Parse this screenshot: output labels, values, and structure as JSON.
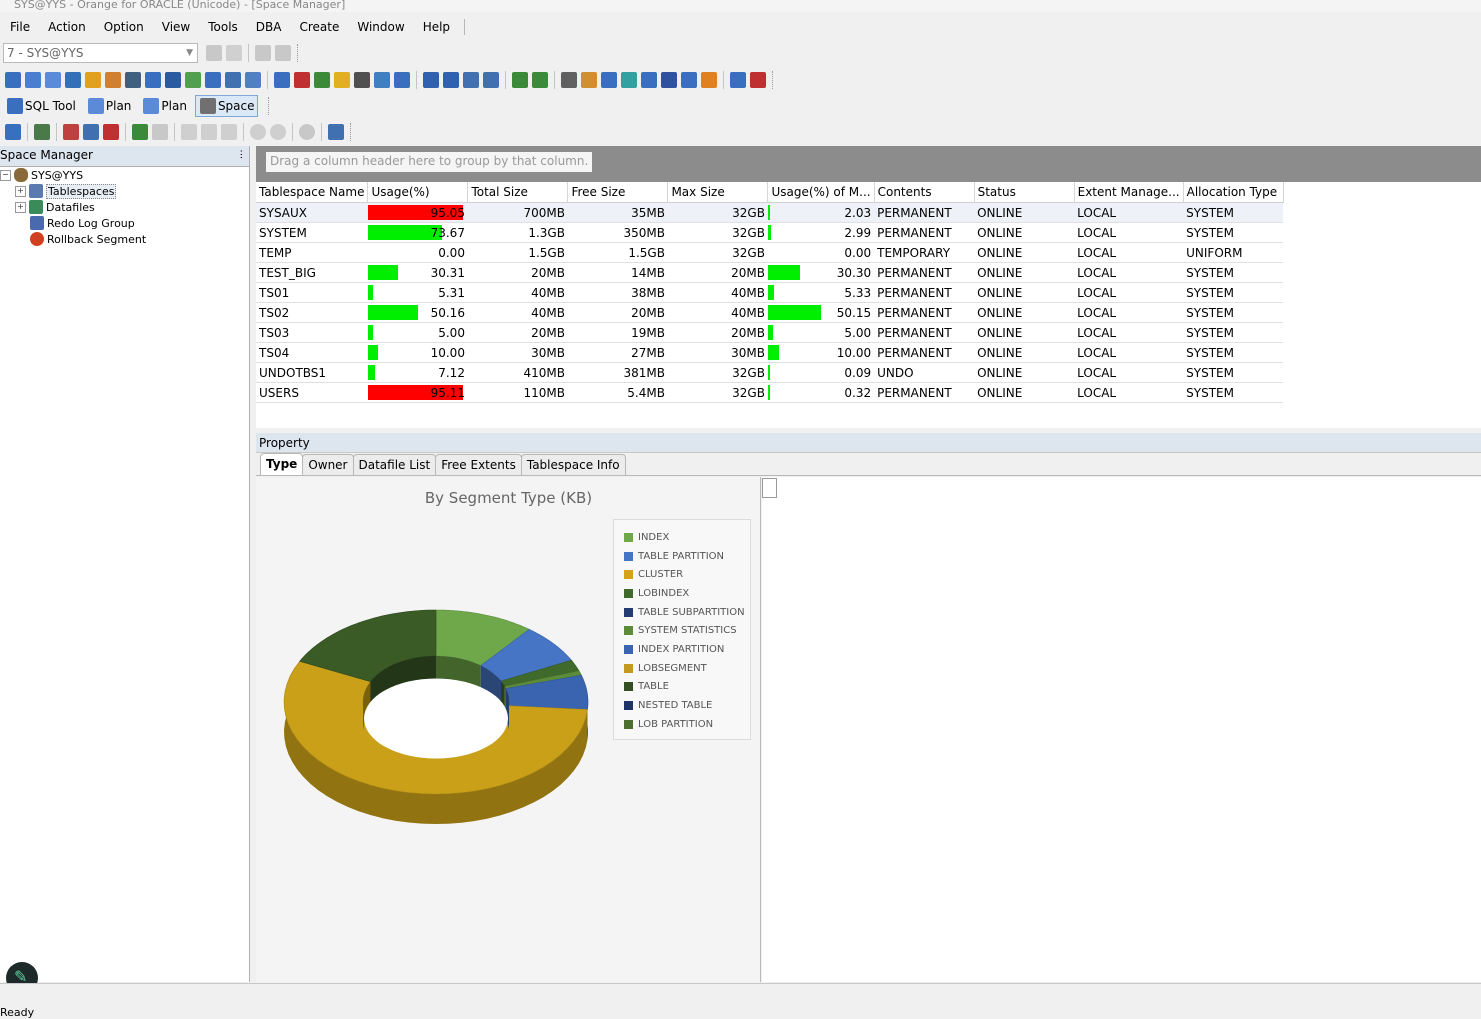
{
  "window": {
    "title": "SYS@YYS - Orange for ORACLE (Unicode) - [Space Manager]"
  },
  "menu": [
    "File",
    "Action",
    "Option",
    "View",
    "Tools",
    "DBA",
    "Create",
    "Window",
    "Help"
  ],
  "connection": {
    "value": "7 - SYS@YYS"
  },
  "tool_tabs": [
    {
      "label": "SQL Tool",
      "icon": "sql-tool-icon"
    },
    {
      "label": "Plan",
      "icon": "plan-icon"
    },
    {
      "label": "Plan",
      "icon": "plan-icon"
    },
    {
      "label": "Space",
      "icon": "space-icon"
    }
  ],
  "left_panel": {
    "title": "Space Manager",
    "tree": {
      "root": "SYS@YYS",
      "children": [
        "Tablespaces",
        "Datafiles",
        "Redo Log Group",
        "Rollback Segment"
      ]
    }
  },
  "grid": {
    "group_hint": "Drag a column header here to group by that column.",
    "columns": [
      "Tablespace Name",
      "Usage(%)",
      "Total Size",
      "Free Size",
      "Max Size",
      "Usage(%) of M...",
      "Contents",
      "Status",
      "Extent Manage...",
      "Allocation Type"
    ],
    "rows": [
      {
        "name": "SYSAUX",
        "usage": "95.05",
        "usage_val": 95.05,
        "total": "700MB",
        "free": "35MB",
        "max": "32GB",
        "usage_max": "2.03",
        "usage_max_val": 2.03,
        "contents": "PERMANENT",
        "status": "ONLINE",
        "extent": "LOCAL",
        "alloc": "SYSTEM"
      },
      {
        "name": "SYSTEM",
        "usage": "73.67",
        "usage_val": 73.67,
        "total": "1.3GB",
        "free": "350MB",
        "max": "32GB",
        "usage_max": "2.99",
        "usage_max_val": 2.99,
        "contents": "PERMANENT",
        "status": "ONLINE",
        "extent": "LOCAL",
        "alloc": "SYSTEM"
      },
      {
        "name": "TEMP",
        "usage": "0.00",
        "usage_val": 0,
        "total": "1.5GB",
        "free": "1.5GB",
        "max": "32GB",
        "usage_max": "0.00",
        "usage_max_val": 0,
        "contents": "TEMPORARY",
        "status": "ONLINE",
        "extent": "LOCAL",
        "alloc": "UNIFORM"
      },
      {
        "name": "TEST_BIG",
        "usage": "30.31",
        "usage_val": 30.31,
        "total": "20MB",
        "free": "14MB",
        "max": "20MB",
        "usage_max": "30.30",
        "usage_max_val": 30.3,
        "contents": "PERMANENT",
        "status": "ONLINE",
        "extent": "LOCAL",
        "alloc": "SYSTEM"
      },
      {
        "name": "TS01",
        "usage": "5.31",
        "usage_val": 5.31,
        "total": "40MB",
        "free": "38MB",
        "max": "40MB",
        "usage_max": "5.33",
        "usage_max_val": 5.33,
        "contents": "PERMANENT",
        "status": "ONLINE",
        "extent": "LOCAL",
        "alloc": "SYSTEM"
      },
      {
        "name": "TS02",
        "usage": "50.16",
        "usage_val": 50.16,
        "total": "40MB",
        "free": "20MB",
        "max": "40MB",
        "usage_max": "50.15",
        "usage_max_val": 50.15,
        "contents": "PERMANENT",
        "status": "ONLINE",
        "extent": "LOCAL",
        "alloc": "SYSTEM"
      },
      {
        "name": "TS03",
        "usage": "5.00",
        "usage_val": 5.0,
        "total": "20MB",
        "free": "19MB",
        "max": "20MB",
        "usage_max": "5.00",
        "usage_max_val": 5.0,
        "contents": "PERMANENT",
        "status": "ONLINE",
        "extent": "LOCAL",
        "alloc": "SYSTEM"
      },
      {
        "name": "TS04",
        "usage": "10.00",
        "usage_val": 10.0,
        "total": "30MB",
        "free": "27MB",
        "max": "30MB",
        "usage_max": "10.00",
        "usage_max_val": 10.0,
        "contents": "PERMANENT",
        "status": "ONLINE",
        "extent": "LOCAL",
        "alloc": "SYSTEM"
      },
      {
        "name": "UNDOTBS1",
        "usage": "7.12",
        "usage_val": 7.12,
        "total": "410MB",
        "free": "381MB",
        "max": "32GB",
        "usage_max": "0.09",
        "usage_max_val": 0.09,
        "contents": "UNDO",
        "status": "ONLINE",
        "extent": "LOCAL",
        "alloc": "SYSTEM"
      },
      {
        "name": "USERS",
        "usage": "95.11",
        "usage_val": 95.11,
        "total": "110MB",
        "free": "5.4MB",
        "max": "32GB",
        "usage_max": "0.32",
        "usage_max_val": 0.32,
        "contents": "PERMANENT",
        "status": "ONLINE",
        "extent": "LOCAL",
        "alloc": "SYSTEM"
      }
    ],
    "colors": {
      "high": "#ff0000",
      "normal": "#00ee00"
    }
  },
  "property": {
    "title": "Property",
    "tabs": [
      "Type",
      "Owner",
      "Datafile List",
      "Free Extents",
      "Tablespace Info"
    ],
    "active_tab": "Type"
  },
  "chart_data": {
    "type": "pie",
    "subtype": "3d-donut",
    "title": "By Segment Type (KB)",
    "legend_position": "right",
    "legend": [
      "INDEX",
      "TABLE PARTITION",
      "CLUSTER",
      "LOBINDEX",
      "TABLE SUBPARTITION",
      "SYSTEM STATISTICS",
      "INDEX PARTITION",
      "LOBSEGMENT",
      "TABLE",
      "NESTED TABLE",
      "LOB PARTITION"
    ],
    "legend_colors": [
      "#6fa84a",
      "#4575c4",
      "#d4a31a",
      "#3f6a2c",
      "#243c70",
      "#5c8c3a",
      "#3a64b0",
      "#c29a20",
      "#354f24",
      "#1e3466",
      "#4c6e30"
    ],
    "slices": [
      {
        "name": "INDEX",
        "value": 10.5,
        "color": "#6fa84a"
      },
      {
        "name": "TABLE PARTITION",
        "value": 7.0,
        "color": "#4575c4"
      },
      {
        "name": "LOBINDEX",
        "value": 2.0,
        "color": "#3f6a2c"
      },
      {
        "name": "SYSTEM STATISTICS",
        "value": 0.8,
        "color": "#5c8c3a"
      },
      {
        "name": "INDEX PARTITION",
        "value": 6.0,
        "color": "#3a64b0"
      },
      {
        "name": "LOBSEGMENT",
        "value": 56.0,
        "color": "#c9a017"
      },
      {
        "name": "TABLE",
        "value": 17.7,
        "color": "#3a5a26"
      }
    ]
  },
  "status": {
    "text": "Ready"
  }
}
